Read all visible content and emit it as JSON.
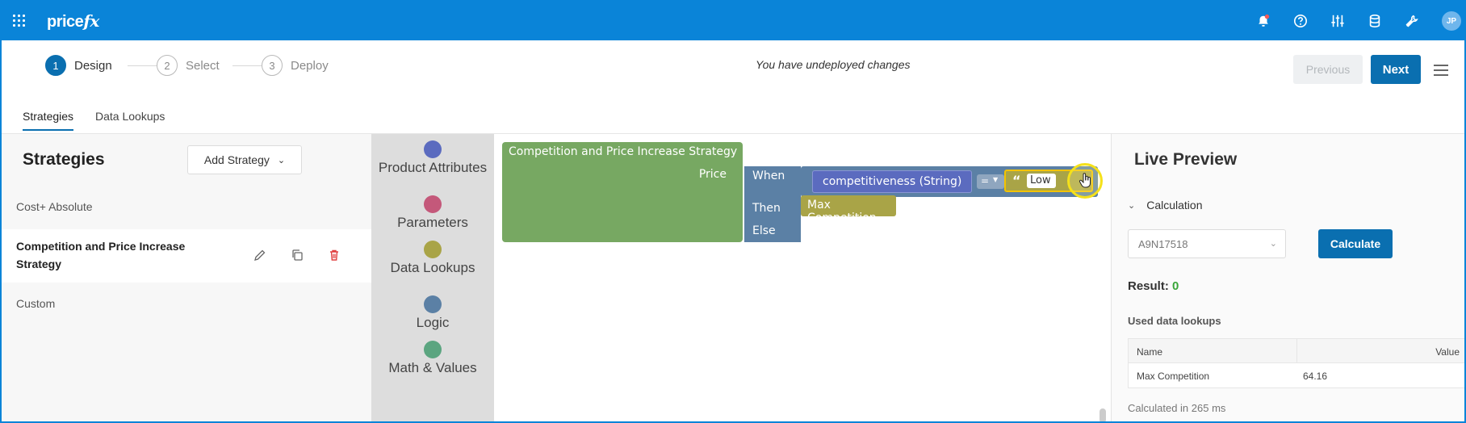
{
  "app": {
    "brand_main": "price",
    "brand_fx": "fx",
    "avatar_initials": "JP"
  },
  "header_icons": [
    "bell-alert-icon",
    "help-icon",
    "sliders-icon",
    "database-icon",
    "tools-icon"
  ],
  "stepper": {
    "steps": [
      {
        "num": "1",
        "label": "Design",
        "active": true
      },
      {
        "num": "2",
        "label": "Select",
        "active": false
      },
      {
        "num": "3",
        "label": "Deploy",
        "active": false
      }
    ],
    "status": "You have undeployed changes",
    "previous_label": "Previous",
    "next_label": "Next"
  },
  "tabs": [
    {
      "label": "Strategies",
      "active": true
    },
    {
      "label": "Data Lookups",
      "active": false
    }
  ],
  "strategies_panel": {
    "title": "Strategies",
    "add_label": "Add Strategy",
    "items": [
      {
        "label": "Cost+ Absolute"
      },
      {
        "label": "Competition and Price Increase Strategy",
        "selected": true
      },
      {
        "label": "Custom"
      }
    ]
  },
  "toolbox": {
    "categories": [
      {
        "label": "Product Attributes",
        "color": "#5b6bbf"
      },
      {
        "label": "Parameters",
        "color": "#c4587a"
      },
      {
        "label": "Data Lookups",
        "color": "#a9a447"
      },
      {
        "label": "Logic",
        "color": "#5b80a5"
      },
      {
        "label": "Math & Values",
        "color": "#5ba580"
      }
    ]
  },
  "workspace": {
    "strategy_block": "Competition and Price Increase Strategy",
    "price_label": "Price",
    "when_label": "When",
    "then_label": "Then",
    "else_label": "Else",
    "attribute_block": "competitiveness (String)",
    "operator": "=",
    "quote_glyph": "“",
    "string_value": "Low",
    "then_value": "Max Competition",
    "colors": {
      "strategy": "#77a862",
      "logic": "#5b80a5",
      "attribute": "#5b6bbf",
      "lookup": "#a9a447"
    }
  },
  "preview": {
    "title": "Live Preview",
    "section_label": "Calculation",
    "product_value": "A9N17518",
    "calculate_label": "Calculate",
    "result_label": "Result:",
    "result_value": "0",
    "used_lookups_label": "Used data lookups",
    "table": {
      "columns": [
        "Name",
        "Value"
      ],
      "rows": [
        {
          "name": "Max Competition",
          "value": "64.16"
        }
      ]
    },
    "calc_time": "Calculated in 265 ms"
  }
}
